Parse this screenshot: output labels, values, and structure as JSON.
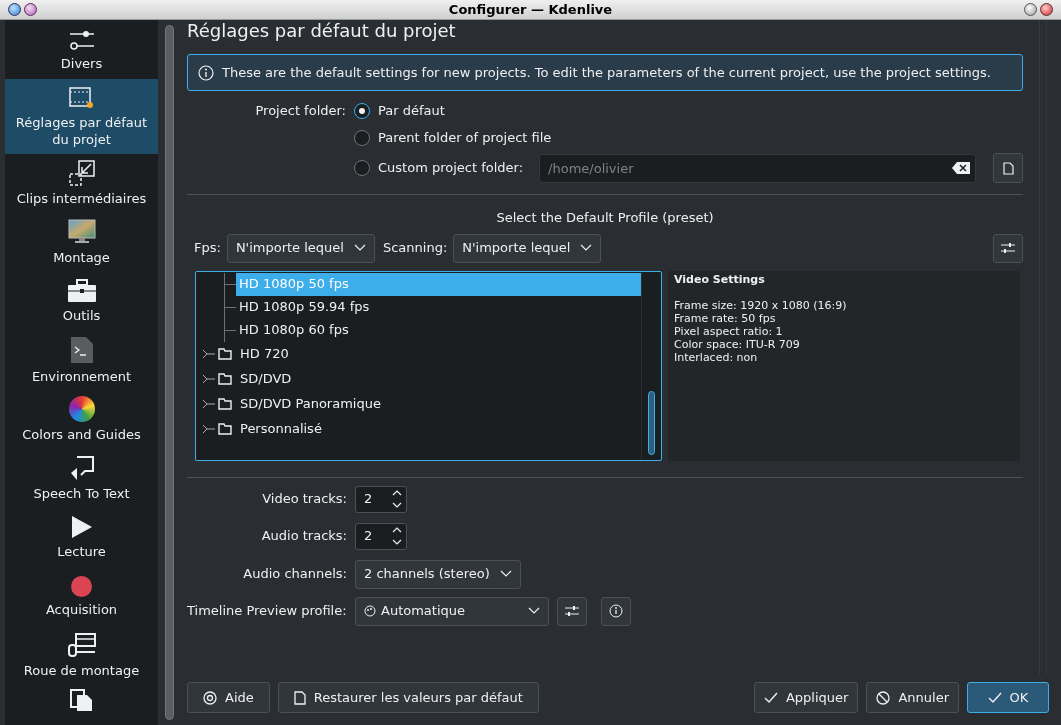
{
  "window": {
    "title": "Configurer — Kdenlive"
  },
  "sidebar": {
    "items": [
      {
        "label": "Divers",
        "kind": "sliders",
        "selected": false
      },
      {
        "label": "Réglages par défaut du projet",
        "kind": "film",
        "selected": true
      },
      {
        "label": "Clips intermédiaires",
        "kind": "shrink",
        "selected": false
      },
      {
        "label": "Montage",
        "kind": "monitor",
        "selected": false
      },
      {
        "label": "Outils",
        "kind": "toolbox",
        "selected": false
      },
      {
        "label": "Environnement",
        "kind": "terminal",
        "selected": false
      },
      {
        "label": "Colors and Guides",
        "kind": "wheel",
        "selected": false
      },
      {
        "label": "Speech To Text",
        "kind": "speech",
        "selected": false
      },
      {
        "label": "Lecture",
        "kind": "play",
        "selected": false
      },
      {
        "label": "Acquisition",
        "kind": "record",
        "selected": false
      },
      {
        "label": "Roue de montage",
        "kind": "wheelbox",
        "selected": false
      },
      {
        "kind": "copy",
        "selected": false
      }
    ]
  },
  "page": {
    "title": "Réglages par défaut du projet",
    "info": "These are the default settings for new projects. To edit the parameters of the current project, use the project settings.",
    "project_folder": {
      "label": "Project folder:",
      "options": [
        {
          "label": "Par défaut",
          "selected": true
        },
        {
          "label": "Parent folder of project file",
          "selected": false
        },
        {
          "label": "Custom project folder:",
          "selected": false,
          "kind": "path"
        }
      ],
      "path": {
        "placeholder": "/home/olivier"
      }
    },
    "profile": {
      "title": "Select the Default Profile (preset)",
      "fps": {
        "label": "Fps:",
        "value": "N'importe lequel"
      },
      "scanning": {
        "label": "Scanning:",
        "value": "N'importe lequel"
      },
      "tree": [
        {
          "label": "HD 1080p 50 fps",
          "kind": "profile",
          "selected": true
        },
        {
          "label": "HD 1080p 59.94 fps",
          "kind": "profile",
          "selected": false
        },
        {
          "label": "HD 1080p 60 fps",
          "kind": "profile",
          "selected": false
        },
        {
          "label": "HD 720",
          "kind": "folder",
          "selected": false
        },
        {
          "label": "SD/DVD",
          "kind": "folder",
          "selected": false
        },
        {
          "label": "SD/DVD Panoramique",
          "kind": "folder",
          "selected": false
        },
        {
          "label": "Personnalisé",
          "kind": "folder",
          "selected": false
        }
      ],
      "details": {
        "title": "Video Settings",
        "lines": [
          "Frame size: 1920 x 1080 (16:9)",
          "Frame rate: 50 fps",
          "Pixel aspect ratio: 1",
          "Color space: ITU-R 709",
          "Interlaced: non"
        ]
      }
    },
    "video_tracks": {
      "label": "Video tracks:",
      "value": "2"
    },
    "audio_tracks": {
      "label": "Audio tracks:",
      "value": "2"
    },
    "audio_channels": {
      "label": "Audio channels:",
      "value": "2 channels (stereo)"
    },
    "preview": {
      "label": "Timeline Preview profile:",
      "value": "Automatique"
    }
  },
  "buttons": {
    "left": [
      {
        "label": "Aide",
        "kind": "help"
      },
      {
        "label": "Restaurer les valeurs par défaut",
        "kind": "doc"
      }
    ],
    "right": [
      {
        "label": "Appliquer",
        "kind": "check",
        "primary": false
      },
      {
        "label": "Annuler",
        "kind": "cancel",
        "primary": false
      },
      {
        "label": "OK",
        "kind": "check",
        "primary": true
      }
    ]
  }
}
